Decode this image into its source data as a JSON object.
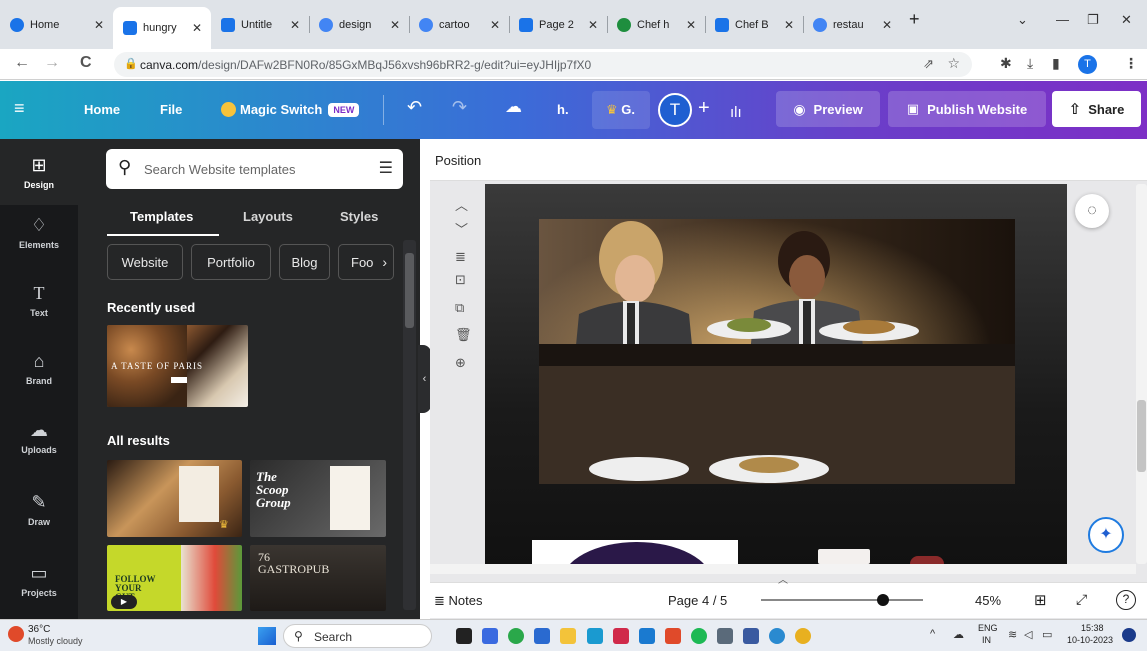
{
  "browser": {
    "tabs": [
      {
        "label": "Home",
        "color": "#1a73e8"
      },
      {
        "label": "hungry",
        "color": "#1a73e8"
      },
      {
        "label": "Untitle",
        "color": "#1a73e8"
      },
      {
        "label": "design",
        "color": "#4285f4"
      },
      {
        "label": "cartoo",
        "color": "#4285f4"
      },
      {
        "label": "Page 2",
        "color": "#1a73e8"
      },
      {
        "label": "Chef h",
        "color": "#1e8e3e"
      },
      {
        "label": "Chef B",
        "color": "#1a73e8"
      },
      {
        "label": "restau",
        "color": "#4285f4"
      }
    ],
    "new_tab": "+",
    "url_host": "canva.com",
    "url_path": "/design/DAFw2BFN0Ro/85GxMBqJ56xvsh96bRR2-g/edit?ui=eyJHIjp7fX0",
    "profile_initial": "T"
  },
  "topbar": {
    "home": "Home",
    "file": "File",
    "magic_switch": "Magic Switch",
    "new_badge": "NEW",
    "title_short": "h.",
    "premium_short": "G.",
    "avatar_initial": "T",
    "preview": "Preview",
    "publish": "Publish Website",
    "share": "Share"
  },
  "rail": [
    {
      "label": "Design",
      "icon": "design-icon"
    },
    {
      "label": "Elements",
      "icon": "elements-icon"
    },
    {
      "label": "Text",
      "icon": "text-icon"
    },
    {
      "label": "Brand",
      "icon": "brand-icon"
    },
    {
      "label": "Uploads",
      "icon": "uploads-icon"
    },
    {
      "label": "Draw",
      "icon": "draw-icon"
    },
    {
      "label": "Projects",
      "icon": "projects-icon"
    }
  ],
  "panel": {
    "search_placeholder": "Search Website templates",
    "tabs": [
      "Templates",
      "Layouts",
      "Styles"
    ],
    "chips": [
      "Website",
      "Portfolio",
      "Blog",
      "Foo"
    ],
    "recently_used": "Recently used",
    "recent_thumb_text": "A TASTE OF PARIS",
    "all_results": "All results",
    "thumbs": [
      "The Scoop Group",
      "FOLLOW YOUR GUT",
      "76 GASTROPUB"
    ]
  },
  "editor": {
    "context_label": "Position",
    "notes": "Notes",
    "page_indicator": "Page 4 / 5",
    "zoom": "45%",
    "zoom_fraction": 0.45
  },
  "taskbar": {
    "temperature": "36°C",
    "weather": "Mostly cloudy",
    "search": "Search",
    "lang1": "ENG",
    "lang2": "IN",
    "time": "15:38",
    "date": "10-10-2023"
  }
}
